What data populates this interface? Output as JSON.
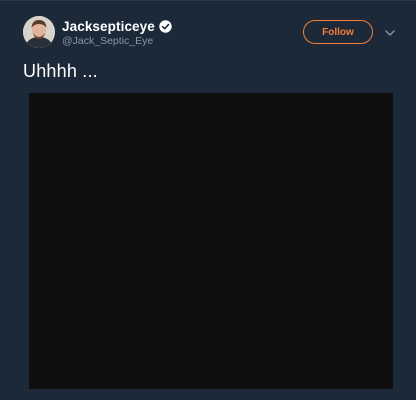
{
  "author": {
    "display_name": "Jacksepticeye",
    "handle": "@Jack_Septic_Eye",
    "verified": true,
    "avatar_icon": "user-avatar"
  },
  "actions": {
    "follow_label": "Follow",
    "more_icon": "chevron-down-icon"
  },
  "tweet": {
    "text": "Uhhhh ..."
  },
  "colors": {
    "background": "#1c2938",
    "accent": "#f57c3a",
    "verified": "#ffffff",
    "handle": "#8899a6",
    "media": "#0f0f0f"
  }
}
